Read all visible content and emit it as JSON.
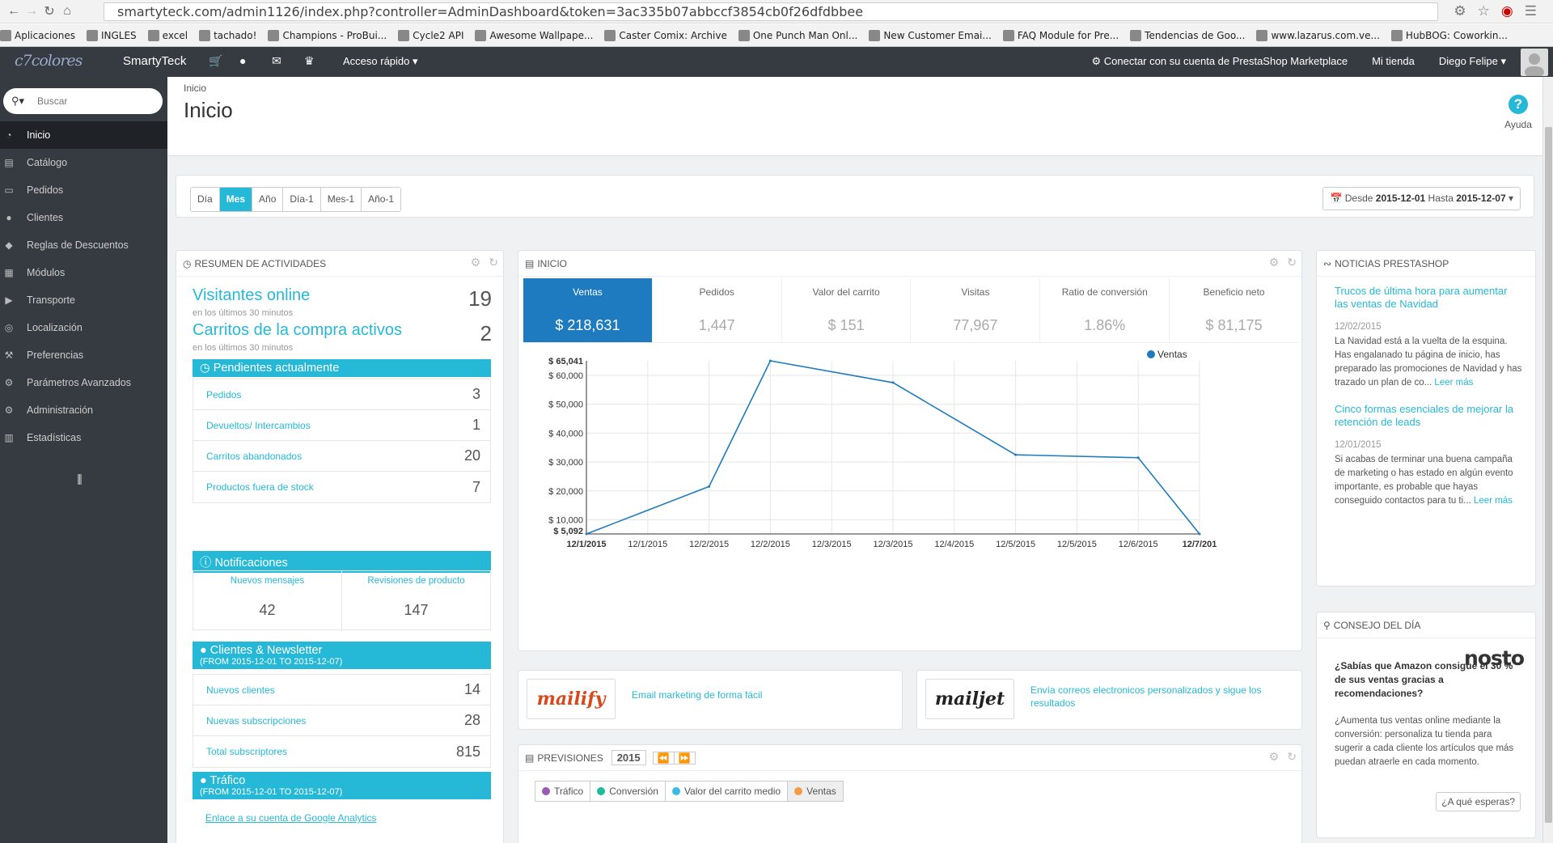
{
  "browser": {
    "url": "smartyteck.com/admin1126/index.php?controller=AdminDashboard&token=3ac335b07abbccf3854cb0f26dfdbbee",
    "bookmarks": [
      "Aplicaciones",
      "INGLES",
      "excel",
      "tachado!",
      "Champions - ProBui...",
      "Cycle2 API",
      "Awesome Wallpape...",
      "Caster Comix: Archive",
      "One Punch Man Onl...",
      "New Customer Emai...",
      "FAQ Module for Pre...",
      "Tendencias de Goo...",
      "www.lazarus.com.ve...",
      "HubBOG: Coworkin..."
    ]
  },
  "header": {
    "logo_text": "c7colores",
    "shop_name": "SmartyTeck",
    "quick_access": "Acceso rápido",
    "marketplace": "Conectar con su cuenta de PrestaShop Marketplace",
    "my_shop": "Mi tienda",
    "user": "Diego Felipe"
  },
  "sidebar": {
    "search_placeholder": "Buscar",
    "items": [
      {
        "label": "Inicio",
        "icon": "dashboard-icon"
      },
      {
        "label": "Catálogo",
        "icon": "book-icon"
      },
      {
        "label": "Pedidos",
        "icon": "card-icon"
      },
      {
        "label": "Clientes",
        "icon": "users-icon"
      },
      {
        "label": "Reglas de Descuentos",
        "icon": "tag-icon"
      },
      {
        "label": "Módulos",
        "icon": "puzzle-icon"
      },
      {
        "label": "Transporte",
        "icon": "truck-icon"
      },
      {
        "label": "Localización",
        "icon": "globe-icon"
      },
      {
        "label": "Preferencias",
        "icon": "wrench-icon"
      },
      {
        "label": "Parámetros Avanzados",
        "icon": "cogs-icon"
      },
      {
        "label": "Administración",
        "icon": "cog-icon"
      },
      {
        "label": "Estadísticas",
        "icon": "chart-icon"
      }
    ]
  },
  "page": {
    "breadcrumb": "Inicio",
    "title": "Inicio",
    "help": "Ayuda"
  },
  "period": {
    "buttons": [
      "Día",
      "Mes",
      "Año",
      "Día-1",
      "Mes-1",
      "Año-1"
    ],
    "active": "Mes",
    "from_label": "Desde",
    "from": "2015-12-01",
    "to_label": "Hasta",
    "to": "2015-12-07"
  },
  "activity": {
    "title": "Resumen de actividades",
    "online_label": "Visitantes online",
    "online_sub": "en los últimos 30 minutos",
    "online_value": "19",
    "carts_label": "Carritos de la compra activos",
    "carts_sub": "en los últimos 30 minutos",
    "carts_value": "2",
    "pending_title": "Pendientes actualmente",
    "pending": [
      {
        "label": "Pedidos",
        "value": "3"
      },
      {
        "label": "Devueltos/ Intercambios",
        "value": "1"
      },
      {
        "label": "Carritos abandonados",
        "value": "20"
      },
      {
        "label": "Productos fuera de stock",
        "value": "7"
      }
    ],
    "notif_title": "Notificaciones",
    "notif": [
      {
        "label": "Nuevos mensajes",
        "value": "42"
      },
      {
        "label": "Revisiones de producto",
        "value": "147"
      }
    ],
    "clients_title": "Clientes & Newsletter",
    "clients_range": "(FROM 2015-12-01 TO 2015-12-07)",
    "clients": [
      {
        "label": "Nuevos clientes",
        "value": "14"
      },
      {
        "label": "Nuevas subscripciones",
        "value": "28"
      },
      {
        "label": "Total subscriptores",
        "value": "815"
      }
    ],
    "traffic_title": "Tráfico",
    "traffic_range": "(FROM 2015-12-01 TO 2015-12-07)",
    "traffic_link": "Enlace a su cuenta de Google Analytics"
  },
  "dashboard": {
    "title": "Inicio",
    "kpis": [
      {
        "label": "Ventas",
        "value": "$ 218,631"
      },
      {
        "label": "Pedidos",
        "value": "1,447"
      },
      {
        "label": "Valor del carrito",
        "value": "$ 151"
      },
      {
        "label": "Visitas",
        "value": "77,967"
      },
      {
        "label": "Ratio de conversión",
        "value": "1.86%"
      },
      {
        "label": "Beneficio neto",
        "value": "$ 81,175"
      }
    ]
  },
  "chart_data": {
    "type": "line",
    "series": [
      {
        "name": "Ventas",
        "values": [
          5092,
          21500,
          65041,
          57500,
          32500,
          31500,
          5092
        ]
      }
    ],
    "x": [
      "12/1/2015",
      "12/1/2015",
      "12/2/2015",
      "12/2/2015",
      "12/3/2015",
      "12/3/2015",
      "12/4/2015",
      "12/5/2015",
      "12/5/2015",
      "12/6/2015",
      "12/7/201"
    ],
    "point_x_index": [
      0,
      2,
      3,
      5,
      7,
      9,
      10
    ],
    "y_ticks": [
      "$ 10,000",
      "$ 20,000",
      "$ 30,000",
      "$ 40,000",
      "$ 50,000",
      "$ 60,000"
    ],
    "y_min_label": "$ 5,092",
    "y_max_label": "$ 65,041",
    "ylim": [
      5092,
      65041
    ],
    "legend": "top-right",
    "grid": true,
    "color": "#1e7bbf"
  },
  "ads": [
    {
      "name": "mailify",
      "text": "Email marketing de forma fácil"
    },
    {
      "name": "mailjet",
      "text": "Envía correos electronicos personalizados y sigue los resultados"
    }
  ],
  "forecast": {
    "title": "Previsiones",
    "year": "2015",
    "tabs": [
      {
        "label": "Tráfico",
        "color": "#9b59b6"
      },
      {
        "label": "Conversión",
        "color": "#1abc9c"
      },
      {
        "label": "Valor del carrito medio",
        "color": "#3bbce8"
      },
      {
        "label": "Ventas",
        "color": "#f39c47"
      }
    ]
  },
  "news": {
    "title": "Noticias PrestaShop",
    "more": "Leer más",
    "items": [
      {
        "title": "Trucos de última hora para aumentar las ventas de Navidad",
        "date": "12/02/2015",
        "text": "La Navidad está a la vuelta de la esquina. Has engalanado tu página de inicio, has preparado las promociones de Navidad y has trazado un plan de co..."
      },
      {
        "title": "Cinco formas esenciales de mejorar la retención de leads",
        "date": "12/01/2015",
        "text": "Si acabas de terminar una buena campaña de marketing o has estado en algún evento importante, es probable que hayas conseguido contactos para tu ti..."
      }
    ]
  },
  "tip": {
    "title": "Consejo del día",
    "brand": "nosto",
    "question": "¿Sabías que Amazon consigue el 30 % de sus ventas gracias a recomendaciones?",
    "body": "¿Aumenta tus ventas online mediante la conversión: personaliza tu tienda para sugerir a cada cliente los artículos que más puedan atraerle en cada momento.",
    "button": "¿A qué esperas?"
  }
}
